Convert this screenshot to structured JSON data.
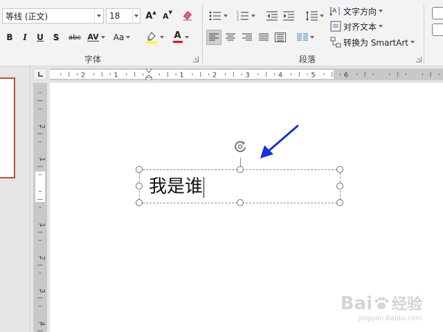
{
  "font": {
    "name_value": "等线 (正文)",
    "size_value": "18",
    "group_label": "字体",
    "buttons": {
      "bold": "B",
      "italic": "I",
      "underline": "U",
      "shadow": "S",
      "strike": "abc",
      "spacing": "AV",
      "case": "Aa",
      "grow": "A",
      "shrink": "A",
      "font_color": "A"
    }
  },
  "paragraph": {
    "group_label": "段落",
    "text_direction_label": "文字方向",
    "align_text_label": "对齐文本",
    "smartart_label": "转换为 SmartArt"
  },
  "rulers": {
    "h_labels": [
      "2",
      "1",
      "1",
      "2",
      "3",
      "4",
      "5",
      "6"
    ],
    "v_labels": [
      "2",
      "1",
      "1",
      "2",
      "3",
      "4"
    ]
  },
  "textbox": {
    "text": "我是谁"
  },
  "watermark": {
    "brand": "Bai",
    "sub": "经验",
    "url": "jingyan.baidu.com"
  },
  "colors": {
    "highlight": "#ffff00",
    "font_color": "#ff0000",
    "arrow": "#1430e0",
    "thumb_border": "#c0502e"
  }
}
